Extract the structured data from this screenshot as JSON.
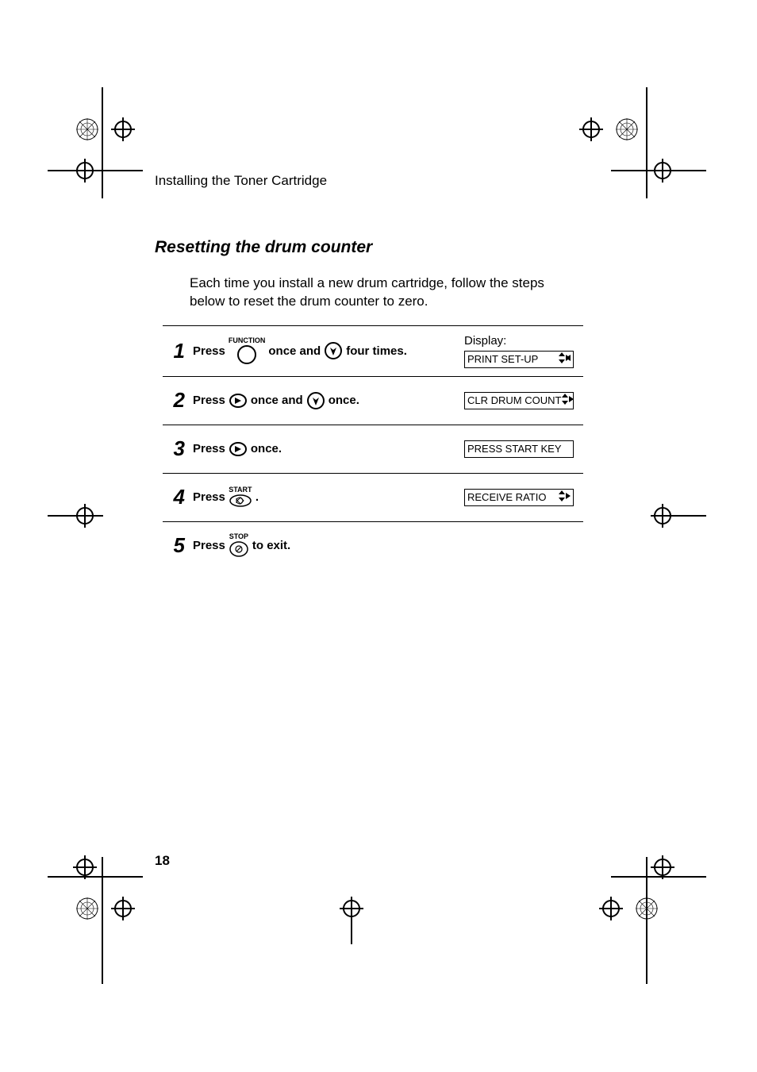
{
  "running_head": "Installing the Toner Cartridge",
  "section_title": "Resetting the drum counter",
  "intro": "Each time you install a new drum cartridge, follow the steps below to reset the drum counter to zero.",
  "display_label": "Display:",
  "steps": {
    "s1": {
      "num": "1",
      "t1": "Press",
      "func_label": "FUNCTION",
      "t2": "once and",
      "t3": "four times.",
      "lcd": "PRINT SET-UP"
    },
    "s2": {
      "num": "2",
      "t1": "Press",
      "t2": "once and",
      "t3": "once.",
      "lcd": "CLR DRUM COUNT"
    },
    "s3": {
      "num": "3",
      "t1": "Press",
      "t2": "once.",
      "lcd": "PRESS START KEY"
    },
    "s4": {
      "num": "4",
      "t1": "Press",
      "start_label": "START",
      "t2": ".",
      "lcd": "RECEIVE RATIO"
    },
    "s5": {
      "num": "5",
      "t1": "Press",
      "stop_label": "STOP",
      "t2": "to exit."
    }
  },
  "page_number": "18"
}
